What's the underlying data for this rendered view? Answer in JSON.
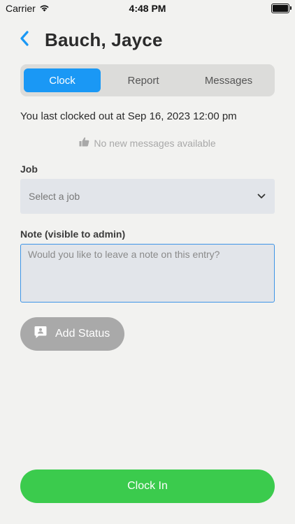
{
  "status_bar": {
    "carrier": "Carrier",
    "time": "4:48 PM",
    "wifi_icon": "wifi-icon",
    "battery_icon": "battery-icon"
  },
  "header": {
    "back_icon": "chevron-left-icon",
    "title": "Bauch, Jayce",
    "accent_color": "#1a98f5"
  },
  "tabs": [
    {
      "label": "Clock",
      "active": true
    },
    {
      "label": "Report",
      "active": false
    },
    {
      "label": "Messages",
      "active": false
    }
  ],
  "last_clocked_text": "You last clocked out at Sep 16, 2023 12:00 pm",
  "messages_status": {
    "icon": "thumbs-up-icon",
    "text": "No new messages available"
  },
  "job": {
    "label": "Job",
    "value": "",
    "placeholder": "Select a job",
    "icon": "chevron-down-icon"
  },
  "note": {
    "label": "Note (visible to admin)",
    "value": "",
    "placeholder": "Would you like to leave a note on this entry?"
  },
  "add_status_button": {
    "label": "Add Status",
    "icon": "status-message-icon",
    "color": "#a9a9a9"
  },
  "clock_in_button": {
    "label": "Clock In",
    "color": "#3bcb4d"
  }
}
